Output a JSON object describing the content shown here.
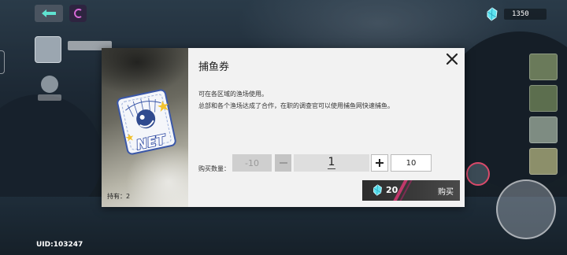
{
  "currency": {
    "amount": "1350",
    "icon": "crystal-gem-icon"
  },
  "player": {
    "uid": "UID:103247"
  },
  "dialog": {
    "title": "捕鱼券",
    "description": [
      "可在各区域的渔场使用。",
      "总部和各个渔场达成了合作，在职的调查官可以使用捕鱼网快速捕鱼。"
    ],
    "owned": "持有：2",
    "item_art_text": "NET",
    "quantity_label": "购买数量：",
    "minus_ten": "-10",
    "quantity": "1",
    "plus_ten": "10",
    "price": "20",
    "buy_label": "购买"
  },
  "colors": {
    "dialog_bg": "#f2f2f2",
    "buy_button_bg": "#2d2d2d",
    "accent_streak": "#c0386a",
    "gem_cyan": "#5fe3f0"
  }
}
